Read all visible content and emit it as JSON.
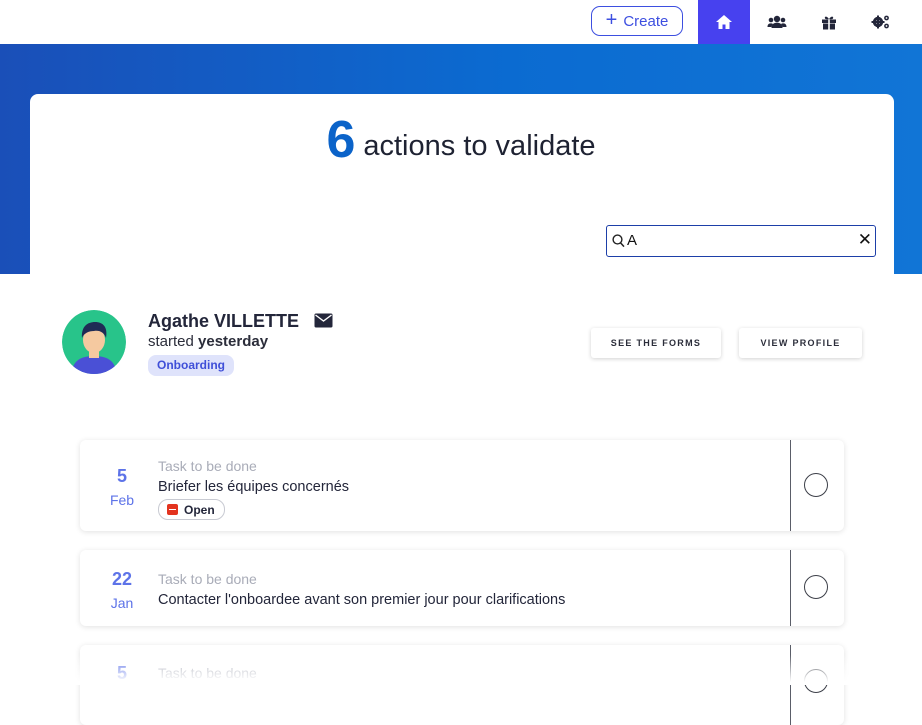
{
  "nav": {
    "create_label": "Create",
    "icons": [
      "home-icon",
      "users-icon",
      "gift-icon",
      "settings-icon"
    ],
    "active": "home-icon",
    "accent_color": "#4741ef"
  },
  "header": {
    "count": "6",
    "headline": "actions to validate"
  },
  "search": {
    "value": "A"
  },
  "profile": {
    "name": "Agathe VILLETTE",
    "started_prefix": "started",
    "started_when": "yesterday",
    "tag": "Onboarding",
    "see_forms_label": "SEE THE FORMS",
    "view_profile_label": "VIEW PROFILE"
  },
  "tasks": [
    {
      "day": "5",
      "month": "Feb",
      "kind": "Task to be done",
      "title": "Briefer les équipes concernés",
      "attachment_label": "Open"
    },
    {
      "day": "22",
      "month": "Jan",
      "kind": "Task to be done",
      "title": "Contacter l'onboardee avant son premier jour pour clarifications"
    },
    {
      "day": "5",
      "month": "",
      "kind": "Task to be done",
      "title": ""
    }
  ]
}
